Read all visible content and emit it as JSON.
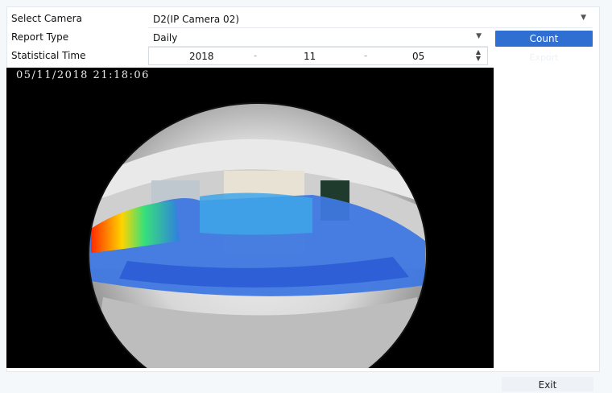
{
  "form": {
    "select_camera_label": "Select Camera",
    "camera_value": "D2(IP Camera 02)",
    "report_type_label": "Report Type",
    "report_type_value": "Daily",
    "statistical_time_label": "Statistical Time",
    "year": "2018",
    "month": "11",
    "day": "05",
    "separator": "-"
  },
  "buttons": {
    "count_label": "Count",
    "ghost_label": "Export",
    "exit_label": "Exit"
  },
  "video": {
    "osd_timestamp": "05/11/2018 21:18:06"
  },
  "colors": {
    "accent": "#2f6fd1",
    "panel_bg": "#ffffff",
    "page_bg": "#f5f8fb"
  }
}
